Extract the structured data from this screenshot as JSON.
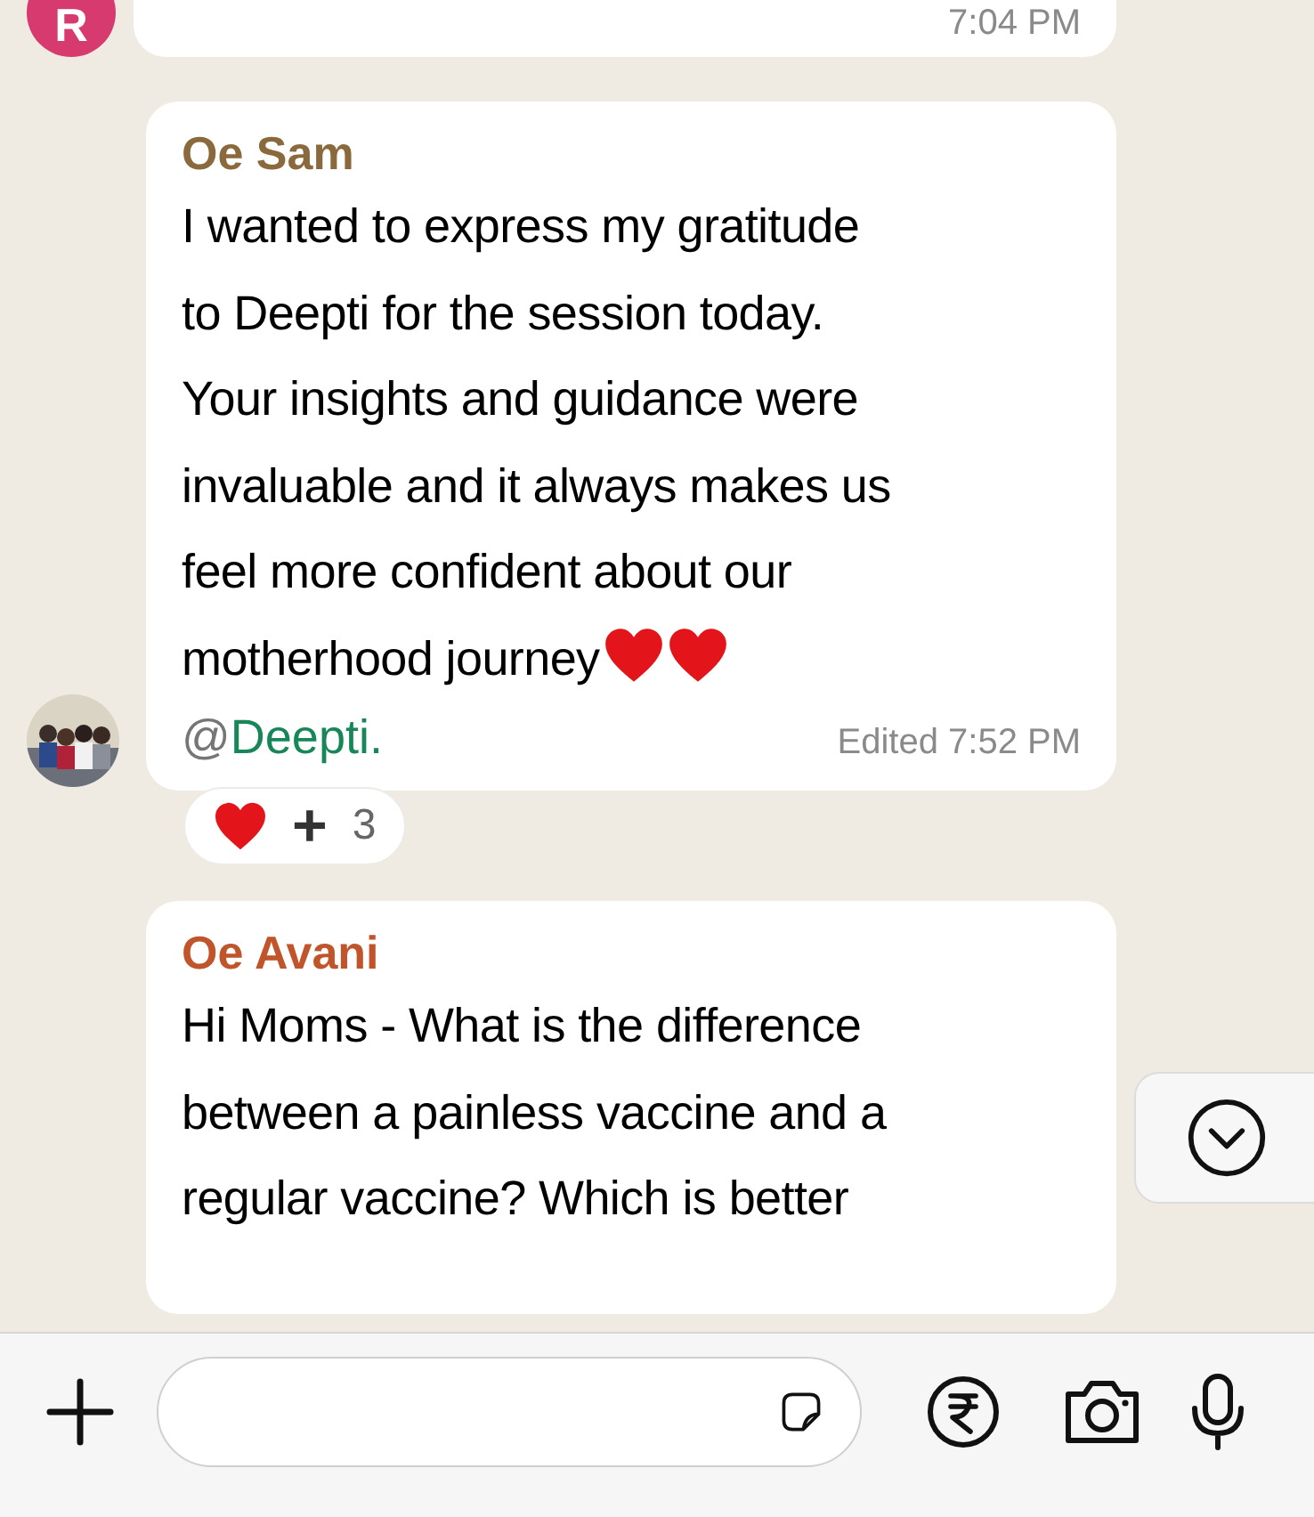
{
  "messages": [
    {
      "kind": "tail",
      "avatar": {
        "kind": "letter",
        "letter": "R",
        "color": "#d63a6e"
      },
      "time": "7:04 PM"
    },
    {
      "kind": "full",
      "avatar": {
        "kind": "picture"
      },
      "sender": "Oe Sam",
      "color": "#8a6a3c",
      "lines": [
        "I wanted to express my gratitude",
        "to Deepti for the session today.",
        "Your insights and guidance were",
        "invaluable and it always makes us",
        "feel more confident about our",
        "motherhood journey"
      ],
      "trailing_emoji": [
        {
          "kind": "heart"
        },
        {
          "kind": "heart"
        }
      ],
      "mention": {
        "prefix": "@",
        "name": "Deepti."
      },
      "time": "Edited 7:52 PM",
      "reaction": {
        "plus": "+",
        "count": "3"
      }
    },
    {
      "kind": "head",
      "sender": "Oe Avani",
      "color": "#c0542a",
      "lines": [
        "Hi Moms - What is the difference",
        "between a painless vaccine and a",
        "regular vaccine? Which is better"
      ]
    }
  ],
  "scroll_down": true
}
